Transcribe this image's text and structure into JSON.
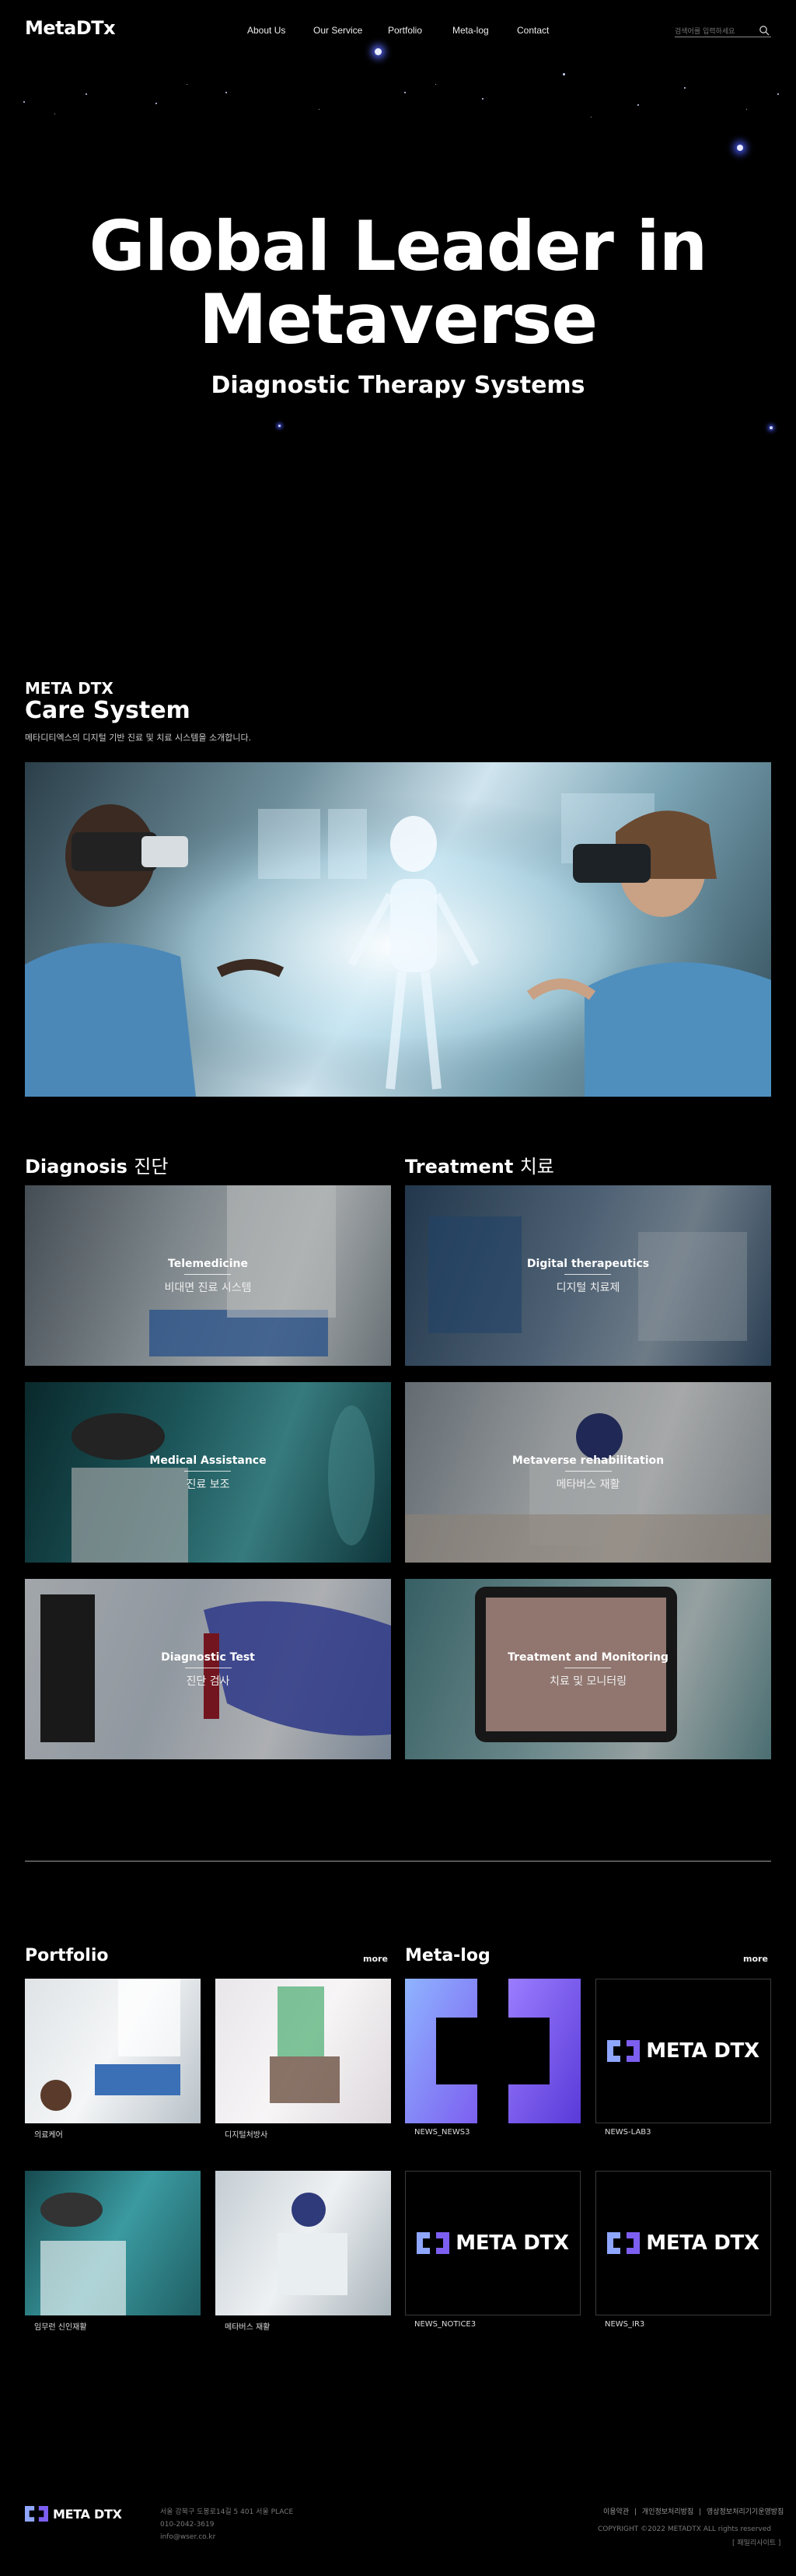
{
  "header": {
    "logo": "MetaDTx",
    "nav": [
      "About Us",
      "Our Service",
      "Portfolio",
      "Meta-log",
      "Contact"
    ],
    "search_placeholder": "검색어를 입력하세요"
  },
  "hero": {
    "title_line1": "Global Leader in",
    "title_line2": "Metaverse",
    "subtitle": "Diagnostic Therapy Systems"
  },
  "care": {
    "eyebrow": "META DTX",
    "title": "Care System",
    "description": "메타디티엑스의 디지털 기반 진료 및 치료 시스템을 소개합니다."
  },
  "diagnosis": {
    "heading_en": "Diagnosis",
    "heading_ko": "진단",
    "items": [
      {
        "en": "Telemedicine",
        "ko": "비대면 진료 시스템"
      },
      {
        "en": "Medical Assistance",
        "ko": "진료 보조"
      },
      {
        "en": "Diagnostic Test",
        "ko": "진단 검사"
      }
    ]
  },
  "treatment": {
    "heading_en": "Treatment",
    "heading_ko": "치료",
    "items": [
      {
        "en": "Digital therapeutics",
        "ko": "디지털 치료제"
      },
      {
        "en": "Metaverse rehabilitation",
        "ko": "메타버스 재활"
      },
      {
        "en": "Treatment and Monitoring",
        "ko": "치료 및 모니터링"
      }
    ]
  },
  "portfolio": {
    "heading": "Portfolio",
    "more": "more",
    "items": [
      "의료케어",
      "디지털처방사",
      "임무런 신인재활",
      "메타버스 재활"
    ]
  },
  "metalog": {
    "heading": "Meta-log",
    "more": "more",
    "brand_text": "META DTX",
    "items": [
      "NEWS_NEWS3",
      "NEWS-LAB3",
      "NEWS_NOTICE3",
      "NEWS_IR3"
    ]
  },
  "footer": {
    "brand_text": "META DTX",
    "address": "서울 강북구 도봉로14길 5 401 서울 PLACE",
    "phone": "010-2042-3619",
    "email": "info@wser.co.kr",
    "links": [
      "이용약관",
      "개인정보처리방침",
      "영상정보처리기기운영방침"
    ],
    "separator": "|",
    "copyright": "COPYRIGHT ©2022 METADTX ALL rights reserved",
    "family_site": "[ 패밀리사이트 ]"
  },
  "colors": {
    "background": "#000000",
    "divider": "#555555",
    "accent_purple": "#7d5cf0",
    "accent_blue": "#6f8dff"
  }
}
